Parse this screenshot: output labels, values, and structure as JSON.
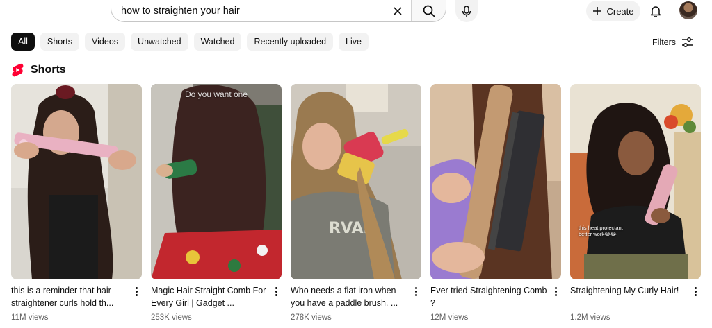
{
  "search": {
    "query": "how to straighten your hair",
    "placeholder": "Search"
  },
  "header": {
    "create_label": "Create"
  },
  "chips": [
    {
      "label": "All",
      "active": true
    },
    {
      "label": "Shorts"
    },
    {
      "label": "Videos"
    },
    {
      "label": "Unwatched"
    },
    {
      "label": "Watched"
    },
    {
      "label": "Recently uploaded"
    },
    {
      "label": "Live"
    }
  ],
  "filters_label": "Filters",
  "shorts": {
    "section_title": "Shorts",
    "brand_color": "#ff0033",
    "items": [
      {
        "title": "this is a reminder that hair straightener curls hold th...",
        "views": "11M views",
        "overlay": ""
      },
      {
        "title": "Magic Hair Straight Comb For Every Girl | Gadget ...",
        "views": "253K views",
        "overlay": "Do you want one"
      },
      {
        "title": "Who needs a flat iron when you have a paddle brush. ...",
        "views": "278K views",
        "overlay": ""
      },
      {
        "title": "Ever tried Straightening Comb ?",
        "views": "12M views",
        "overlay": ""
      },
      {
        "title": "Straightening My Curly Hair!",
        "views": "1.2M views",
        "overlay": "this heat protectant better work😂😂"
      }
    ]
  }
}
